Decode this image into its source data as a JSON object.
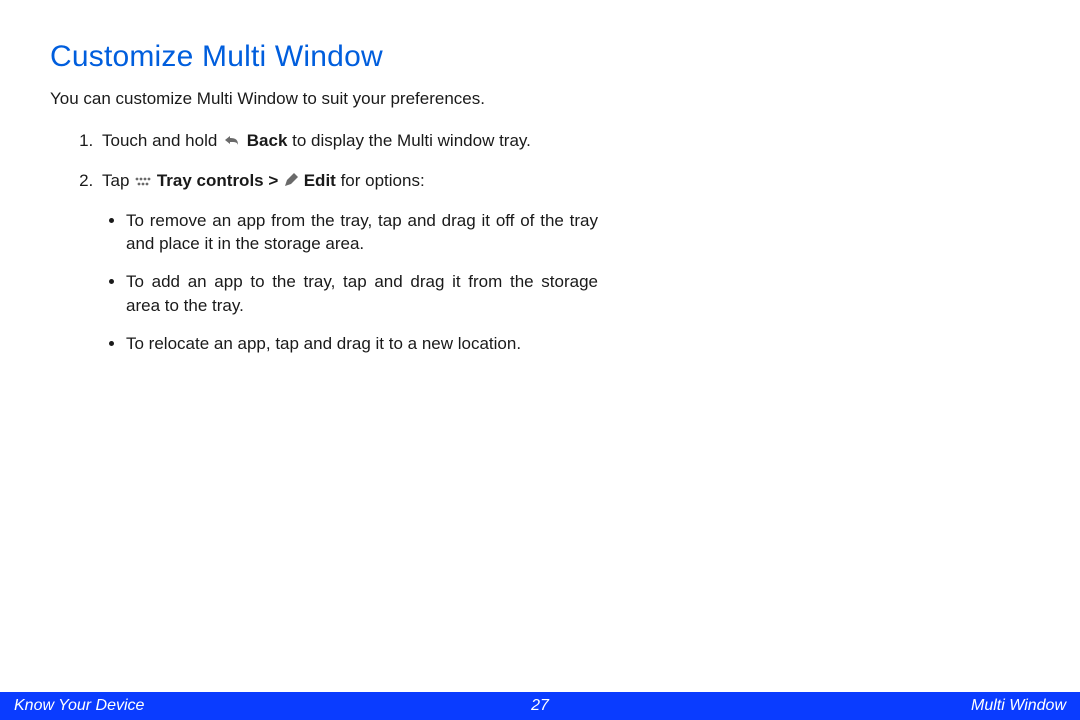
{
  "heading": "Customize Multi Window",
  "intro": "You can customize Multi Window to suit your preferences.",
  "steps": {
    "s1_pre": "Touch and hold ",
    "s1_bold": " Back",
    "s1_post": " to display the Multi window tray.",
    "s2_pre": "Tap ",
    "s2_bold1": " Tray controls > ",
    "s2_bold2": " Edit",
    "s2_post": " for options:"
  },
  "bullets": [
    "To remove an app from the tray, tap and drag it off of the tray and place it in the storage area.",
    "To add an app to the tray, tap and drag it from the storage area to the tray.",
    "To relocate an app, tap and drag it to a new location."
  ],
  "footer": {
    "left": "Know Your Device",
    "page": "27",
    "right": "Multi Window"
  }
}
